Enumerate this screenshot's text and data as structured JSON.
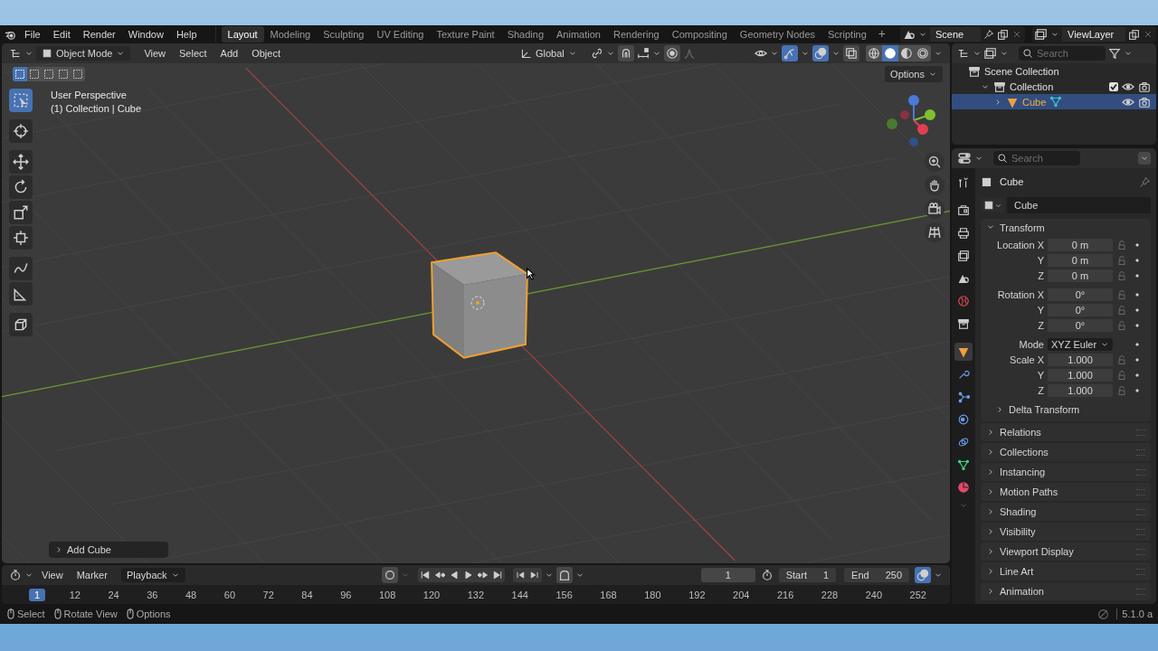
{
  "menu_bar": {
    "menus": [
      "File",
      "Edit",
      "Render",
      "Window",
      "Help"
    ],
    "workspaces": [
      {
        "label": "Layout",
        "selected": true
      },
      {
        "label": "Modeling",
        "selected": false
      },
      {
        "label": "Sculpting",
        "selected": false
      },
      {
        "label": "UV Editing",
        "selected": false
      },
      {
        "label": "Texture Paint",
        "selected": false
      },
      {
        "label": "Shading",
        "selected": false
      },
      {
        "label": "Animation",
        "selected": false
      },
      {
        "label": "Rendering",
        "selected": false
      },
      {
        "label": "Compositing",
        "selected": false
      },
      {
        "label": "Geometry Nodes",
        "selected": false
      },
      {
        "label": "Scripting",
        "selected": false
      }
    ],
    "add_workspace": "+",
    "scene": "Scene",
    "view_layer": "ViewLayer"
  },
  "viewport": {
    "mode": "Object Mode",
    "menus": [
      "View",
      "Select",
      "Add",
      "Object"
    ],
    "orientation": "Global",
    "show_gizmos": true,
    "show_overlays": true,
    "select_modes": [
      {
        "selected": true
      },
      {
        "selected": false
      },
      {
        "selected": false
      },
      {
        "selected": false
      },
      {
        "selected": false
      }
    ],
    "shading": [
      {
        "kind": "wireframe",
        "selected": false
      },
      {
        "kind": "solid",
        "selected": true
      },
      {
        "kind": "material",
        "selected": false
      },
      {
        "kind": "rendered",
        "selected": false
      }
    ],
    "options": "Options",
    "info": [
      "User Perspective",
      "(1) Collection | Cube"
    ],
    "tools": [
      {
        "kind": "select",
        "selected": true
      },
      {
        "kind": "cursor",
        "selected": false
      },
      {
        "kind": "move",
        "selected": false
      },
      {
        "kind": "rotate",
        "selected": false
      },
      {
        "kind": "scale",
        "selected": false
      },
      {
        "kind": "transform",
        "selected": false
      },
      {
        "kind": "annotate",
        "selected": false
      },
      {
        "kind": "measure",
        "selected": false
      },
      {
        "kind": "addcube",
        "selected": false
      }
    ],
    "last_operator": "Add Cube"
  },
  "outliner": {
    "search_placeholder": "Search",
    "tree": [
      {
        "label": "Scene Collection",
        "kind": "scene",
        "children": [
          {
            "label": "Collection",
            "kind": "collection",
            "expanded": true,
            "checked": true,
            "selected": false,
            "children": [
              {
                "label": "Cube",
                "kind": "object",
                "expanded": false,
                "selected": true
              }
            ]
          }
        ]
      }
    ]
  },
  "properties": {
    "search_placeholder": "Search",
    "tabs": [
      {
        "kind": "tool",
        "selected": false
      },
      {
        "kind": "render",
        "selected": false
      },
      {
        "kind": "output",
        "selected": false
      },
      {
        "kind": "view_layer",
        "selected": false
      },
      {
        "kind": "scene",
        "selected": false
      },
      {
        "kind": "world",
        "selected": false
      },
      {
        "kind": "collection",
        "selected": false
      },
      {
        "kind": "object",
        "selected": true
      },
      {
        "kind": "modifiers",
        "selected": false
      },
      {
        "kind": "particles",
        "selected": false
      },
      {
        "kind": "physics",
        "selected": false
      },
      {
        "kind": "constraints",
        "selected": false
      },
      {
        "kind": "data",
        "selected": false
      },
      {
        "kind": "material",
        "selected": false
      }
    ],
    "object_title": "Cube",
    "object_name": "Cube",
    "transform": {
      "title": "Transform",
      "expanded": true,
      "location": [
        {
          "label": "Location X",
          "value": "0 m"
        },
        {
          "label": "Y",
          "value": "0 m"
        },
        {
          "label": "Z",
          "value": "0 m"
        }
      ],
      "rotation": [
        {
          "label": "Rotation X",
          "value": "0°"
        },
        {
          "label": "Y",
          "value": "0°"
        },
        {
          "label": "Z",
          "value": "0°"
        }
      ],
      "mode_label": "Mode",
      "mode": "XYZ Euler",
      "scale": [
        {
          "label": "Scale X",
          "value": "1.000"
        },
        {
          "label": "Y",
          "value": "1.000"
        },
        {
          "label": "Z",
          "value": "1.000"
        }
      ],
      "delta": "Delta Transform"
    },
    "panels": [
      "Relations",
      "Collections",
      "Instancing",
      "Motion Paths",
      "Shading",
      "Visibility",
      "Viewport Display",
      "Line Art",
      "Animation"
    ]
  },
  "timeline": {
    "menus": [
      "View",
      "Marker"
    ],
    "playback": "Playback",
    "current_frame": "1",
    "start_label": "Start",
    "start": "1",
    "end_label": "End",
    "end": "250",
    "ruler": [
      {
        "label": "1",
        "selected": true
      },
      {
        "label": "12",
        "selected": false
      },
      {
        "label": "24",
        "selected": false
      },
      {
        "label": "36",
        "selected": false
      },
      {
        "label": "48",
        "selected": false
      },
      {
        "label": "60",
        "selected": false
      },
      {
        "label": "72",
        "selected": false
      },
      {
        "label": "84",
        "selected": false
      },
      {
        "label": "96",
        "selected": false
      },
      {
        "label": "108",
        "selected": false
      },
      {
        "label": "120",
        "selected": false
      },
      {
        "label": "132",
        "selected": false
      },
      {
        "label": "144",
        "selected": false
      },
      {
        "label": "156",
        "selected": false
      },
      {
        "label": "168",
        "selected": false
      },
      {
        "label": "180",
        "selected": false
      },
      {
        "label": "192",
        "selected": false
      },
      {
        "label": "204",
        "selected": false
      },
      {
        "label": "216",
        "selected": false
      },
      {
        "label": "228",
        "selected": false
      },
      {
        "label": "240",
        "selected": false
      },
      {
        "label": "252",
        "selected": false
      }
    ]
  },
  "status_bar": {
    "hints": [
      "Select",
      "Rotate View",
      "Options"
    ],
    "version": "5.1.0 a"
  }
}
